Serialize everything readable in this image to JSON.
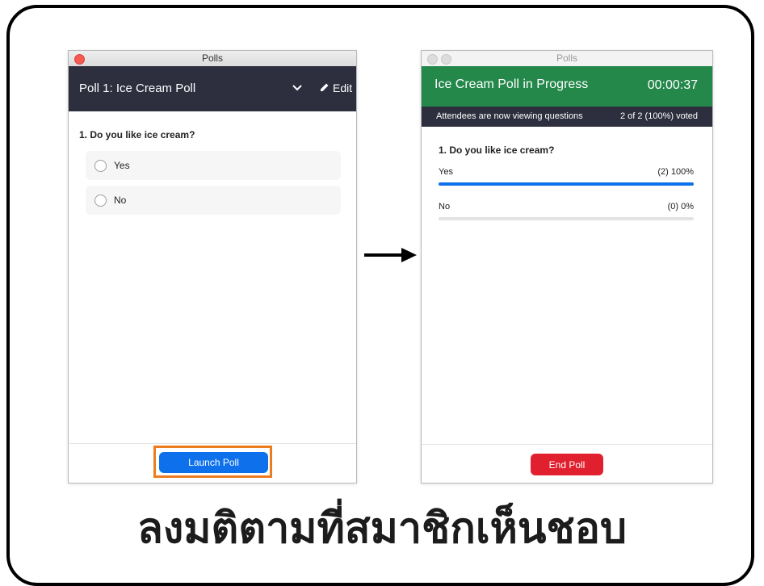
{
  "colors": {
    "left_header_bg": "#2d2f3e",
    "right_header_bg": "#23884a",
    "launch_button": "#0e71eb",
    "end_button": "#e0202e",
    "highlight_border": "#ec7c1f",
    "progress_fill": "#0e71eb"
  },
  "left_window": {
    "title": "Polls",
    "poll_title": "Poll 1: Ice Cream Poll",
    "edit_label": "Edit",
    "question": "1. Do you like ice cream?",
    "options": [
      {
        "label": "Yes"
      },
      {
        "label": "No"
      }
    ],
    "launch_label": "Launch Poll"
  },
  "right_window": {
    "title": "Polls",
    "header_title": "Ice Cream Poll in Progress",
    "timer": "00:00:37",
    "status_text": "Attendees are now viewing questions",
    "voted_text": "2 of 2 (100%) voted",
    "question": "1. Do you like ice cream?",
    "results": [
      {
        "label": "Yes",
        "value": "(2) 100%",
        "fraction": 1.0
      },
      {
        "label": "No",
        "value": "(0) 0%",
        "fraction": 0.0
      }
    ],
    "end_label": "End Poll"
  },
  "caption": "ลงมติตามที่สมาชิกเห็นชอบ"
}
